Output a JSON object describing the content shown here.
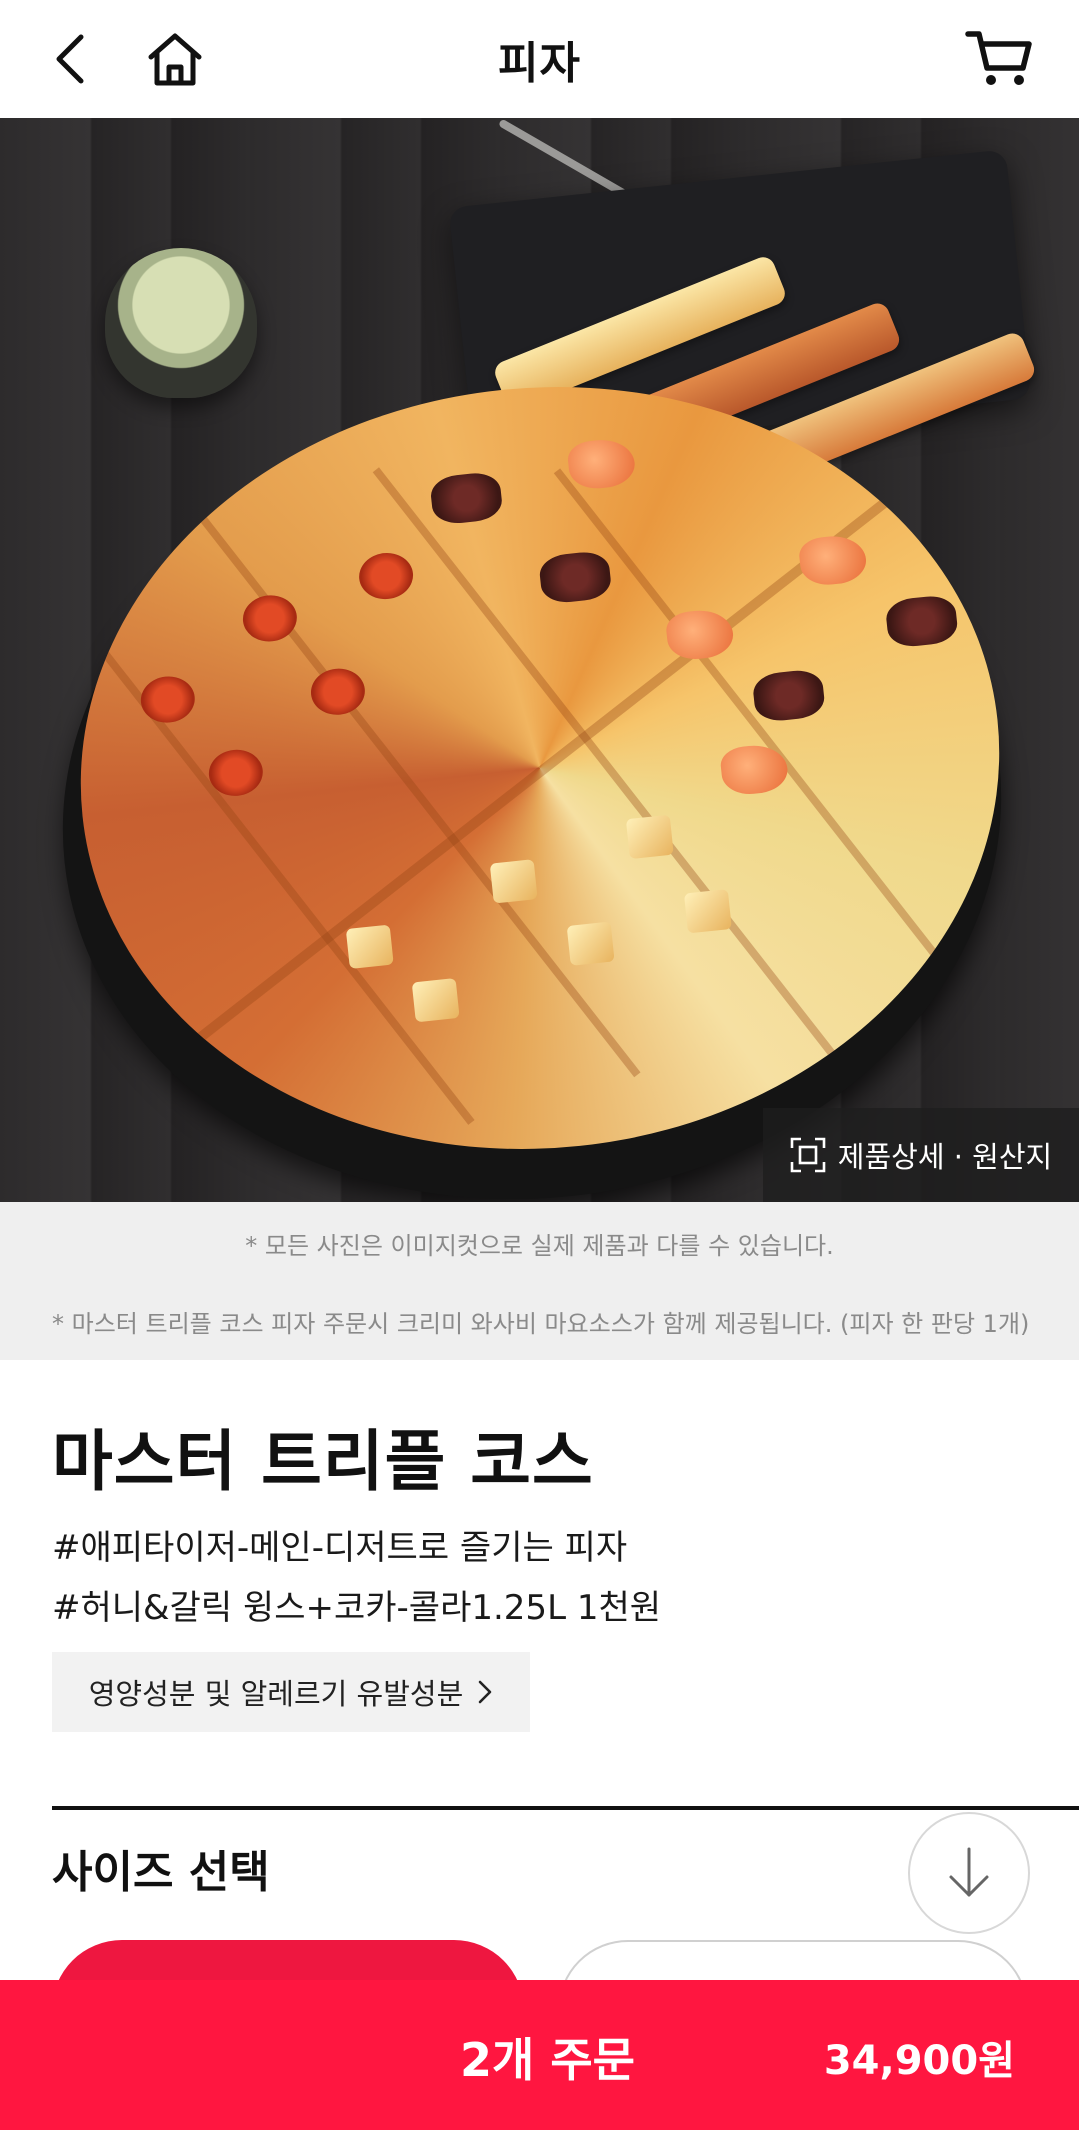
{
  "header": {
    "title": "피자",
    "back_icon": "chevron-left-icon",
    "home_icon": "home-icon",
    "cart_icon": "cart-icon"
  },
  "hero": {
    "detail_label": "제품상세 · 원산지",
    "detail_icon": "scan-frame-icon"
  },
  "notice": {
    "line1": "* 모든 사진은 이미지컷으로 실제 제품과 다를 수 있습니다.",
    "line2": "* 마스터 트리플 코스 피자 주문시 크리미 와사비 마요소스가 함께 제공됩니다. (피자 한 판당 1개)"
  },
  "product": {
    "name": "마스터 트리플 코스",
    "hashtag1": "#애피타이저-메인-디저트로 즐기는 피자",
    "hashtag2": "#허니&갈릭 윙스+코카-콜라1.25L 1천원",
    "nutrition_label": "영양성분 및 알레르기 유발성분"
  },
  "size_section": {
    "title": "사이즈 선택"
  },
  "order": {
    "count_label": "2개 주문",
    "price": "34,900원"
  },
  "colors": {
    "accent": "#ff1640",
    "selected_option": "#ee1740",
    "notice_bg": "#efefef"
  }
}
